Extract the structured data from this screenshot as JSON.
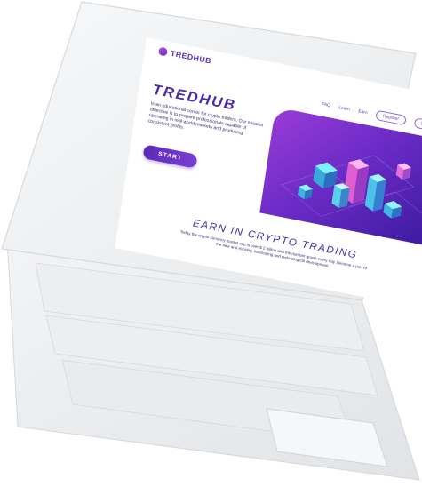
{
  "brand": {
    "name": "TREDHUB",
    "icon": "logo-mark"
  },
  "nav": {
    "links": [
      "FAQ",
      "Learn",
      "Earn"
    ],
    "register_label": "Register",
    "login_label": "Login"
  },
  "hero": {
    "title": "TREDHUB",
    "description": "Is an educational center for crypto traders. Our mission objective is to prepare professionals capable of operating in real world markets and producing consistent profits.",
    "start_label": "START"
  },
  "earn_section": {
    "title": "EARN IN CRYPTO TRADING",
    "description": "Today the crypto currency market cap is over $ 2 trillion and the number grows every day. Become a part of the new and exciting, fascinating and technological development."
  },
  "colors": {
    "accent": "#5a2fb5",
    "gradient_start": "#9a3bd8",
    "gradient_end": "#3a1a9e",
    "laptop_body": "#f4f5f6"
  }
}
